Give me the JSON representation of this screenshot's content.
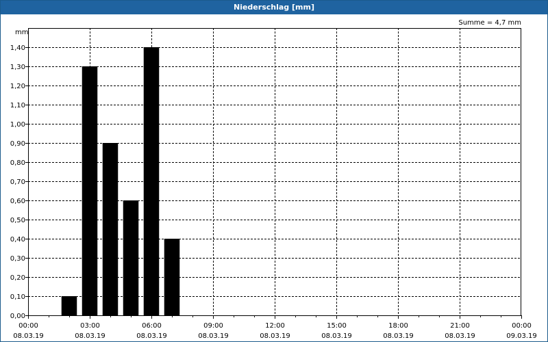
{
  "window": {
    "title": "Niederschlag [mm]"
  },
  "chart_data": {
    "type": "bar",
    "title": "Niederschlag [mm]",
    "ylabel": "mm",
    "annotation": "Summe = 4,7 mm",
    "ylim": [
      0,
      1.5
    ],
    "y_ticks": [
      "0,00",
      "0,10",
      "0,20",
      "0,30",
      "0,40",
      "0,50",
      "0,60",
      "0,70",
      "0,80",
      "0,90",
      "1,00",
      "1,10",
      "1,20",
      "1,30",
      "1,40"
    ],
    "x_ticks": [
      {
        "time": "00:00",
        "date": "08.03.19"
      },
      {
        "time": "03:00",
        "date": "08.03.19"
      },
      {
        "time": "06:00",
        "date": "08.03.19"
      },
      {
        "time": "09:00",
        "date": "08.03.19"
      },
      {
        "time": "12:00",
        "date": "08.03.19"
      },
      {
        "time": "15:00",
        "date": "08.03.19"
      },
      {
        "time": "18:00",
        "date": "08.03.19"
      },
      {
        "time": "21:00",
        "date": "08.03.19"
      },
      {
        "time": "00:00",
        "date": "09.03.19"
      }
    ],
    "xlim": [
      "08.03.19 00:00",
      "09.03.19 00:00"
    ],
    "series": [
      {
        "values": [
          {
            "x": "08.03.19 02:00",
            "y": 0.1
          },
          {
            "x": "08.03.19 03:00",
            "y": 1.3
          },
          {
            "x": "08.03.19 04:00",
            "y": 0.9
          },
          {
            "x": "08.03.19 05:00",
            "y": 0.6
          },
          {
            "x": "08.03.19 06:00",
            "y": 1.4
          },
          {
            "x": "08.03.19 07:00",
            "y": 0.4
          }
        ]
      }
    ],
    "grid": true,
    "bar_color": "#000000"
  }
}
